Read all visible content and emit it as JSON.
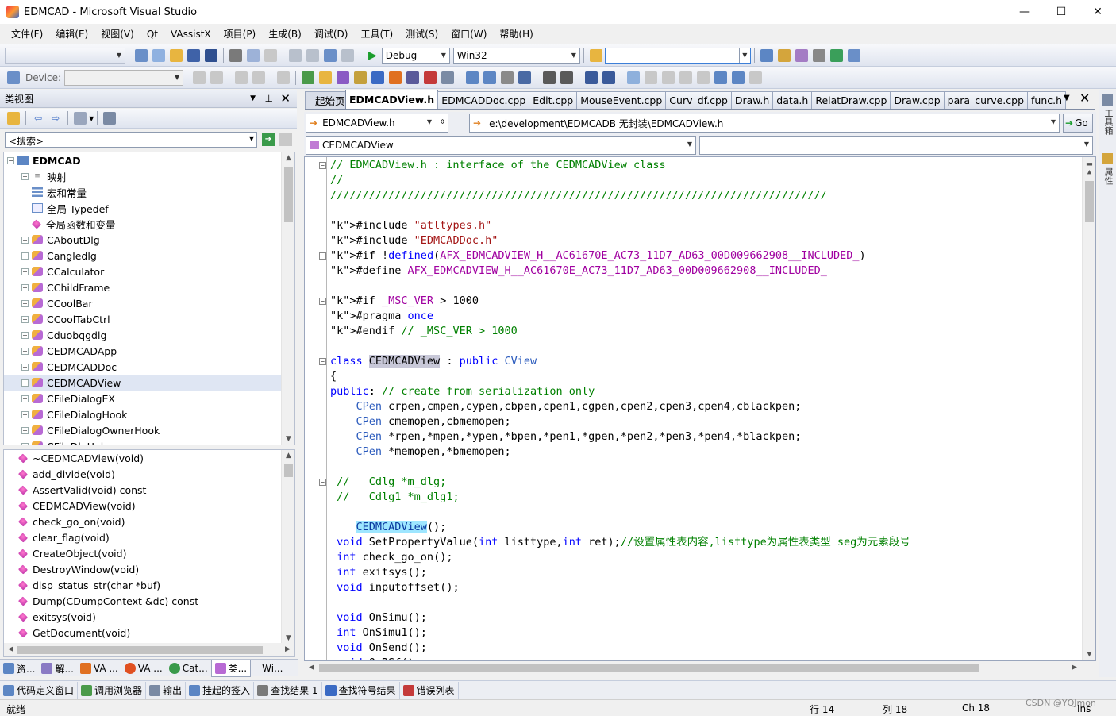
{
  "window": {
    "title": "EDMCAD - Microsoft Visual Studio",
    "minimize": "—",
    "maximize": "☐",
    "close": "✕"
  },
  "menu": [
    "文件(F)",
    "编辑(E)",
    "视图(V)",
    "Qt",
    "VAssistX",
    "项目(P)",
    "生成(B)",
    "调试(D)",
    "工具(T)",
    "测试(S)",
    "窗口(W)",
    "帮助(H)"
  ],
  "toolbar": {
    "config": "Debug",
    "platform": "Win32",
    "find_value": "",
    "device_label": "Device:",
    "device_value": ""
  },
  "class_view": {
    "title": "类视图",
    "search_placeholder": "<搜索>",
    "root": "EDMCAD",
    "items": [
      "映射",
      "宏和常量",
      "全局 Typedef",
      "全局函数和变量",
      "CAboutDlg",
      "Cangledlg",
      "CCalculator",
      "CChildFrame",
      "CCoolBar",
      "CCoolTabCtrl",
      "Cduobqgdlg",
      "CEDMCADApp",
      "CEDMCADDoc",
      "CEDMCADView",
      "CFileDialogEX",
      "CFileDialogHook",
      "CFileDialogOwnerHook",
      "CFileDlgHelper"
    ],
    "members": [
      "~CEDMCADView(void)",
      "add_divide(void)",
      "AssertValid(void) const",
      "CEDMCADView(void)",
      "check_go_on(void)",
      "clear_flag(void)",
      "CreateObject(void)",
      "DestroyWindow(void)",
      "disp_status_str(char *buf)",
      "Dump(CDumpContext &dc) const",
      "exitsys(void)",
      "GetDocument(void)"
    ],
    "bottom_tabs": [
      "资...",
      "解...",
      "VA ...",
      "VA ...",
      "Cat...",
      "类...",
      "Wi..."
    ]
  },
  "doc_tabs": [
    "起始页",
    "EDMCADView.h",
    "EDMCADDoc.cpp",
    "Edit.cpp",
    "MouseEvent.cpp",
    "Curv_df.cpp",
    "Draw.h",
    "data.h",
    "RelatDraw.cpp",
    "Draw.cpp",
    "para_curve.cpp",
    "func.h"
  ],
  "nav": {
    "file_combo": "EDMCADView.h",
    "path": "e:\\development\\EDMCADB 无封装\\EDMCADView.h",
    "go": "Go",
    "class_combo": "CEDMCADView",
    "member_combo": ""
  },
  "code": [
    "// EDMCADView.h : interface of the CEDMCADView class",
    "//",
    "/////////////////////////////////////////////////////////////////////////////",
    "",
    "#include \"atltypes.h\"",
    "#include \"EDMCADDoc.h\"",
    "#if !defined(AFX_EDMCADVIEW_H__AC61670E_AC73_11D7_AD63_00D009662908__INCLUDED_)",
    "#define AFX_EDMCADVIEW_H__AC61670E_AC73_11D7_AD63_00D009662908__INCLUDED_",
    "",
    "#if _MSC_VER > 1000",
    "#pragma once",
    "#endif // _MSC_VER > 1000",
    "",
    "class CEDMCADView : public CView",
    "{",
    "public: // create from serialization only",
    "    CPen crpen,cmpen,cypen,cbpen,cpen1,cgpen,cpen2,cpen3,cpen4,cblackpen;",
    "    CPen cmemopen,cbmemopen;",
    "    CPen *rpen,*mpen,*ypen,*bpen,*pen1,*gpen,*pen2,*pen3,*pen4,*blackpen;",
    "    CPen *memopen,*bmemopen;",
    "",
    " //   Cdlg *m_dlg;",
    " //   Cdlg1 *m_dlg1;",
    "",
    "    CEDMCADView();",
    " void SetPropertyValue(int listtype,int ret);//设置属性表内容,listtype为属性表类型 seg为元素段号",
    " int check_go_on();",
    " int exitsys();",
    " void inputoffset();",
    "",
    " void OnSimu();",
    " int OnSimu1();",
    " void OnSend();",
    " void OnRSf();"
  ],
  "output_tabs": [
    "代码定义窗口",
    "调用浏览器",
    "输出",
    "挂起的签入",
    "查找结果 1",
    "查找符号结果",
    "错误列表"
  ],
  "right_rail": [
    "工具箱",
    "属性"
  ],
  "status": {
    "ready": "就绪",
    "line": "行 14",
    "col": "列 18",
    "ch": "Ch 18",
    "ins": "Ins",
    "watermark": "CSDN @YQJmon"
  }
}
